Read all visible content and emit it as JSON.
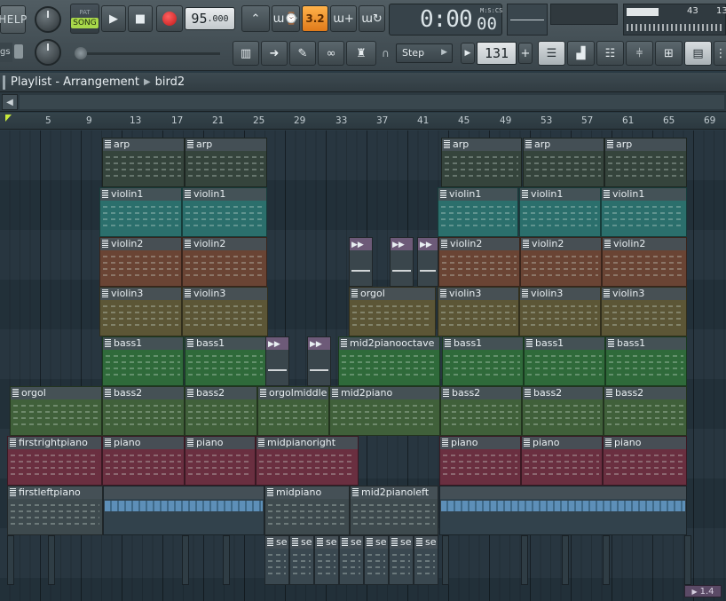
{
  "toolbar": {
    "help_label": "HELP",
    "pat_label": "PAT",
    "song_label": "SONG",
    "tempo_value": "95",
    "tempo_decimal": ".000",
    "time_main": "0:00",
    "time_unit_label": "M:S:CS",
    "time_cs": "00",
    "snap_label": "Step",
    "pattern_number": "131",
    "pattern_plus": "+",
    "cpu_value": "43",
    "cpu_value2": "13",
    "side_label": "gs",
    "rec_icon": "record-icon",
    "play_icon": "play-icon",
    "stop_icon": "stop-icon",
    "accent_orange": "#f09a2a",
    "song_green": "#a8d84a"
  },
  "playlist": {
    "title": "Playlist - Arrangement",
    "arrangement": "bird2"
  },
  "ruler": {
    "bars": [
      "5",
      "9",
      "13",
      "17",
      "21",
      "25",
      "29",
      "33",
      "37",
      "41",
      "45",
      "49",
      "53",
      "57",
      "61",
      "65",
      "69"
    ]
  },
  "clips": [
    {
      "label": "arp",
      "color": "#35443c"
    },
    {
      "label": "arp",
      "color": "#35443c"
    },
    {
      "label": "arp",
      "color": "#35443c"
    },
    {
      "label": "arp",
      "color": "#35443c"
    },
    {
      "label": "arp",
      "color": "#35443c"
    },
    {
      "label": "arp",
      "color": "#35443c"
    },
    {
      "label": "violin1",
      "color": "#2b6f6c"
    },
    {
      "label": "violin1",
      "color": "#2b6f6c"
    },
    {
      "label": "violin1",
      "color": "#2b6f6c"
    },
    {
      "label": "violin1",
      "color": "#2b6f6c"
    },
    {
      "label": "violin1",
      "color": "#2b6f6c"
    },
    {
      "label": "violin2",
      "color": "#6a4434"
    },
    {
      "label": "violin2",
      "color": "#6a4434"
    },
    {
      "label": "violin2",
      "color": "#6a4434"
    },
    {
      "label": "violin2",
      "color": "#6a4434"
    },
    {
      "label": "violin2",
      "color": "#6a4434"
    },
    {
      "label": "violin3",
      "color": "#5c5636"
    },
    {
      "label": "violin3",
      "color": "#5c5636"
    },
    {
      "label": "orgol",
      "color": "#5c5636"
    },
    {
      "label": "violin3",
      "color": "#5c5636"
    },
    {
      "label": "violin3",
      "color": "#5c5636"
    },
    {
      "label": "violin3",
      "color": "#5c5636"
    },
    {
      "label": "bass1",
      "color": "#2f6a3a"
    },
    {
      "label": "bass1",
      "color": "#2f6a3a"
    },
    {
      "label": "mid2pianooctave",
      "color": "#2f6a3a"
    },
    {
      "label": "bass1",
      "color": "#2f6a3a"
    },
    {
      "label": "bass1",
      "color": "#2f6a3a"
    },
    {
      "label": "bass1",
      "color": "#2f6a3a"
    },
    {
      "label": "orgol",
      "color": "#40603a"
    },
    {
      "label": "bass2",
      "color": "#40603a"
    },
    {
      "label": "bass2",
      "color": "#40603a"
    },
    {
      "label": "orgolmiddle",
      "color": "#40603a"
    },
    {
      "label": "mid2piano",
      "color": "#40603a"
    },
    {
      "label": "bass2",
      "color": "#40603a"
    },
    {
      "label": "bass2",
      "color": "#40603a"
    },
    {
      "label": "bass2",
      "color": "#40603a"
    },
    {
      "label": "firstrightpiano",
      "color": "#6a2f40"
    },
    {
      "label": "piano",
      "color": "#6a2f40"
    },
    {
      "label": "piano",
      "color": "#6a2f40"
    },
    {
      "label": "midpianoright",
      "color": "#6a2f40"
    },
    {
      "label": "piano",
      "color": "#6a2f40"
    },
    {
      "label": "piano",
      "color": "#6a2f40"
    },
    {
      "label": "piano",
      "color": "#6a2f40"
    },
    {
      "label": "firstleftpiano",
      "color": "#3e4a4e"
    },
    {
      "label": "midpiano",
      "color": "#3e4a4e"
    },
    {
      "label": "mid2pianoleft",
      "color": "#3e4a4e"
    },
    {
      "label": "se",
      "color": "#3a4850"
    },
    {
      "label": "se",
      "color": "#3a4850"
    },
    {
      "label": "se",
      "color": "#3a4850"
    },
    {
      "label": "se",
      "color": "#3a4850"
    },
    {
      "label": "se",
      "color": "#3a4850"
    },
    {
      "label": "se",
      "color": "#3a4850"
    },
    {
      "label": "se",
      "color": "#3a4850"
    },
    {
      "label": "se",
      "color": "#3a4850"
    }
  ],
  "zoom_indicator": "1.4"
}
